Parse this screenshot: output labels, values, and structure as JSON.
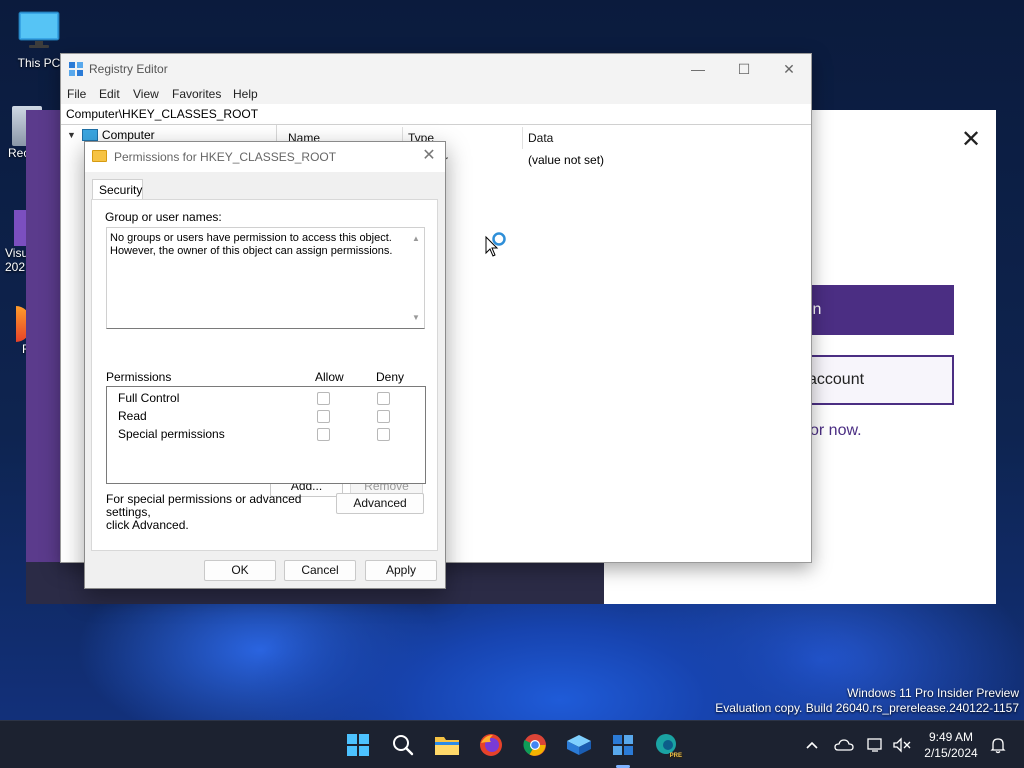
{
  "desktop": {
    "icons": [
      {
        "label": "This PC"
      },
      {
        "label": "Rec"
      },
      {
        "label": "Visu"
      },
      {
        "label": "202"
      },
      {
        "label": "F"
      }
    ]
  },
  "background_window": {
    "signin_text": "in",
    "create_text": "account",
    "notnow_text": "or now."
  },
  "regedit": {
    "title": "Registry Editor",
    "menu": [
      "File",
      "Edit",
      "View",
      "Favorites",
      "Help"
    ],
    "address": "Computer\\HKEY_CLASSES_ROOT",
    "tree_root": "Computer",
    "columns": [
      "Name",
      "Type",
      "Data"
    ],
    "rows": [
      {
        "data": "(value not set)"
      }
    ],
    "type_fragment": "r"
  },
  "permissions_dialog": {
    "title": "Permissions for HKEY_CLASSES_ROOT",
    "tab": "Security",
    "group_label": "Group or user names:",
    "group_message_line1": "No groups or users have permission to access this object.",
    "group_message_line2": "However, the owner of this object can assign permissions.",
    "add_label": "Add...",
    "remove_label": "Remove",
    "permissions_label": "Permissions",
    "allow_label": "Allow",
    "deny_label": "Deny",
    "permissions": [
      {
        "name": "Full Control",
        "allow": false,
        "deny": false
      },
      {
        "name": "Read",
        "allow": false,
        "deny": false
      },
      {
        "name": "Special permissions",
        "allow": false,
        "deny": false
      }
    ],
    "advanced_note_line1": "For special permissions or advanced settings,",
    "advanced_note_line2": "click Advanced.",
    "advanced_label": "Advanced",
    "ok_label": "OK",
    "cancel_label": "Cancel",
    "apply_label": "Apply"
  },
  "watermark": {
    "line1": "Windows 11 Pro Insider Preview",
    "line2": "Evaluation copy. Build 26040.rs_prerelease.240122-1157"
  },
  "taskbar": {
    "time": "9:49 AM",
    "date": "2/15/2024",
    "pinned": [
      "start-icon",
      "search-icon",
      "file-explorer-icon",
      "firefox-icon",
      "chrome-icon",
      "sandbox-icon",
      "registry-editor-icon",
      "edge-pre-icon"
    ],
    "pre_badge": "PRE"
  },
  "colors": {
    "accent_purple": "#4b2e83",
    "taskbar": "#1c2230"
  }
}
